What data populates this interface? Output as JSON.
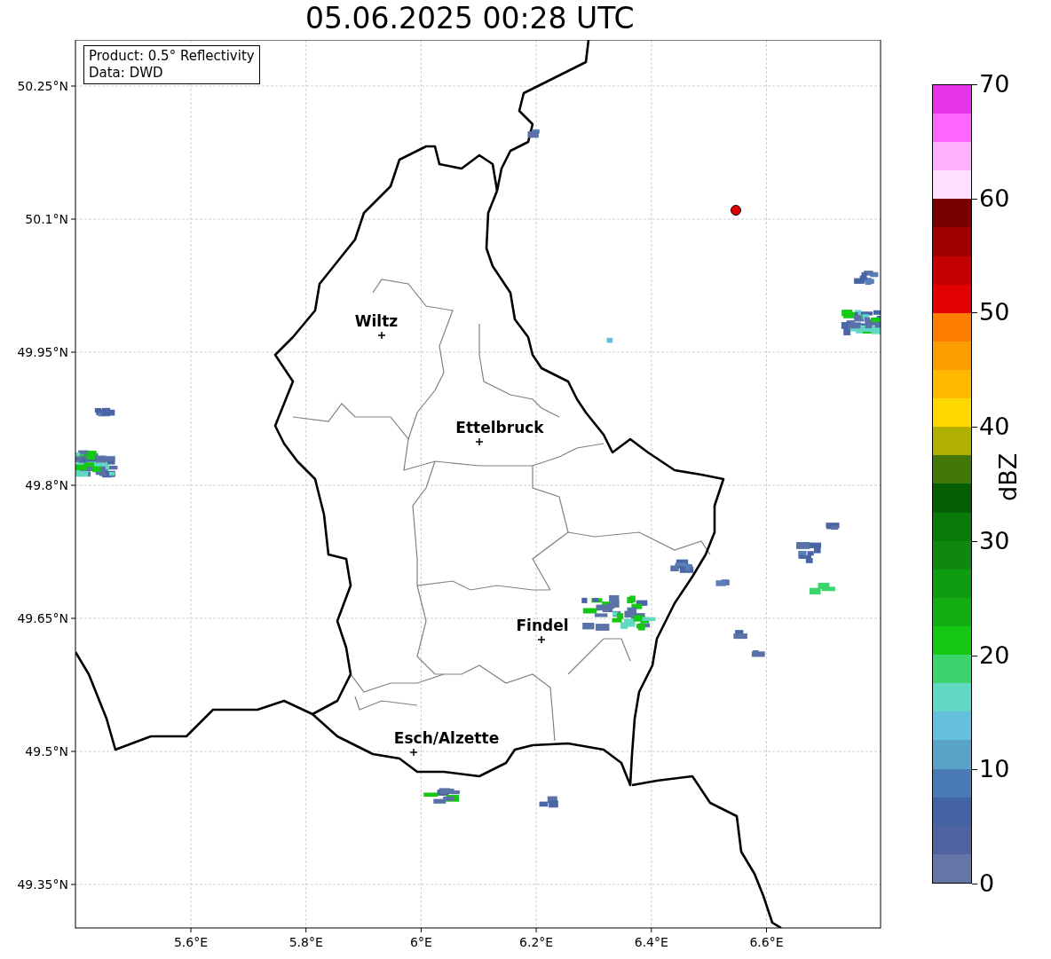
{
  "title": "05.06.2025 00:28 UTC",
  "info_box": {
    "lines": [
      "Product: 0.5° Reflectivity",
      "Data: DWD"
    ]
  },
  "map": {
    "lat_labels": [
      "50.25°N",
      "50.1°N",
      "49.95°N",
      "49.8°N",
      "49.65°N",
      "49.5°N",
      "49.35°N"
    ],
    "lon_labels": [
      "5.6°E",
      "5.8°E",
      "6°E",
      "6.2°E",
      "6.4°E",
      "6.6°E"
    ],
    "cities": [
      {
        "name": "Wiltz"
      },
      {
        "name": "Ettelbruck"
      },
      {
        "name": "Findel"
      },
      {
        "name": "Esch/Alzette"
      }
    ]
  },
  "colorbar": {
    "label": "dBZ",
    "ticks": [
      "70",
      "60",
      "50",
      "40",
      "30",
      "20",
      "10",
      "0"
    ],
    "segments": [
      {
        "color": "#6575a8"
      },
      {
        "color": "#5063a0"
      },
      {
        "color": "#4463a3"
      },
      {
        "color": "#4a7ab4"
      },
      {
        "color": "#5aa2c8"
      },
      {
        "color": "#64c0dc"
      },
      {
        "color": "#60d8c4"
      },
      {
        "color": "#3cd46c"
      },
      {
        "color": "#14c814"
      },
      {
        "color": "#12ae12"
      },
      {
        "color": "#109c10"
      },
      {
        "color": "#108810"
      },
      {
        "color": "#0a7a0a"
      },
      {
        "color": "#055e05"
      },
      {
        "color": "#437808"
      },
      {
        "color": "#b0b000"
      },
      {
        "color": "#fed800"
      },
      {
        "color": "#feb800"
      },
      {
        "color": "#fe9d00"
      },
      {
        "color": "#fe7d00"
      },
      {
        "color": "#e20000"
      },
      {
        "color": "#c40000"
      },
      {
        "color": "#9e0000"
      },
      {
        "color": "#7a0000"
      },
      {
        "color": "#fee0fe"
      },
      {
        "color": "#feb0fe"
      },
      {
        "color": "#fe66fe"
      },
      {
        "color": "#e933e9"
      }
    ]
  }
}
